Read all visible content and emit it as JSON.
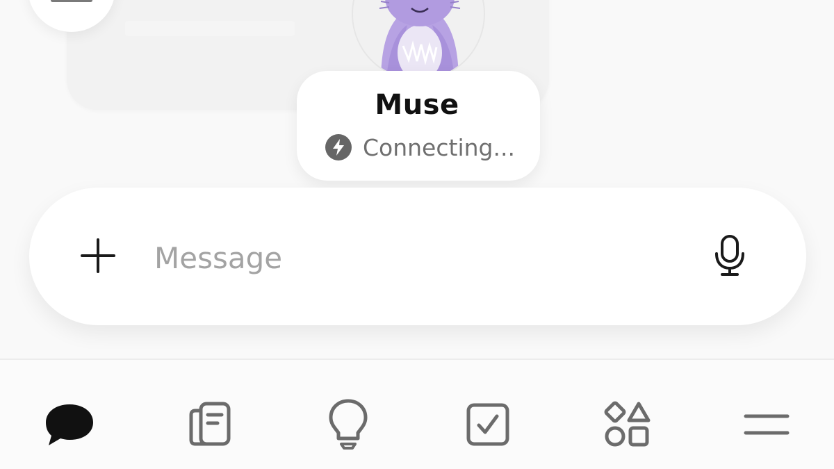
{
  "agent": {
    "name": "Muse",
    "status": "Connecting..."
  },
  "composer": {
    "placeholder": "Message"
  },
  "icons": {
    "avatar": "purple-furry-creature-avatar",
    "status": "bolt-icon",
    "add": "plus-icon",
    "voice": "microphone-icon"
  },
  "bottom_nav": {
    "items": [
      {
        "id": "chat",
        "icon": "chat-bubble-icon",
        "active": true
      },
      {
        "id": "notes",
        "icon": "notebook-icon",
        "active": false
      },
      {
        "id": "ideas",
        "icon": "lightbulb-icon",
        "active": false
      },
      {
        "id": "tasks",
        "icon": "checkbox-icon",
        "active": false
      },
      {
        "id": "apps",
        "icon": "shapes-icon",
        "active": false
      },
      {
        "id": "menu",
        "icon": "menu-icon",
        "active": false
      }
    ]
  },
  "colors": {
    "background": "#f9f9f9",
    "card": "#ffffff",
    "icon_active": "#111111",
    "icon_inactive": "#6b6b6b",
    "status_text": "#6f6f6f",
    "placeholder": "#a3a3a3",
    "avatar_purple": "#b39ee0"
  }
}
